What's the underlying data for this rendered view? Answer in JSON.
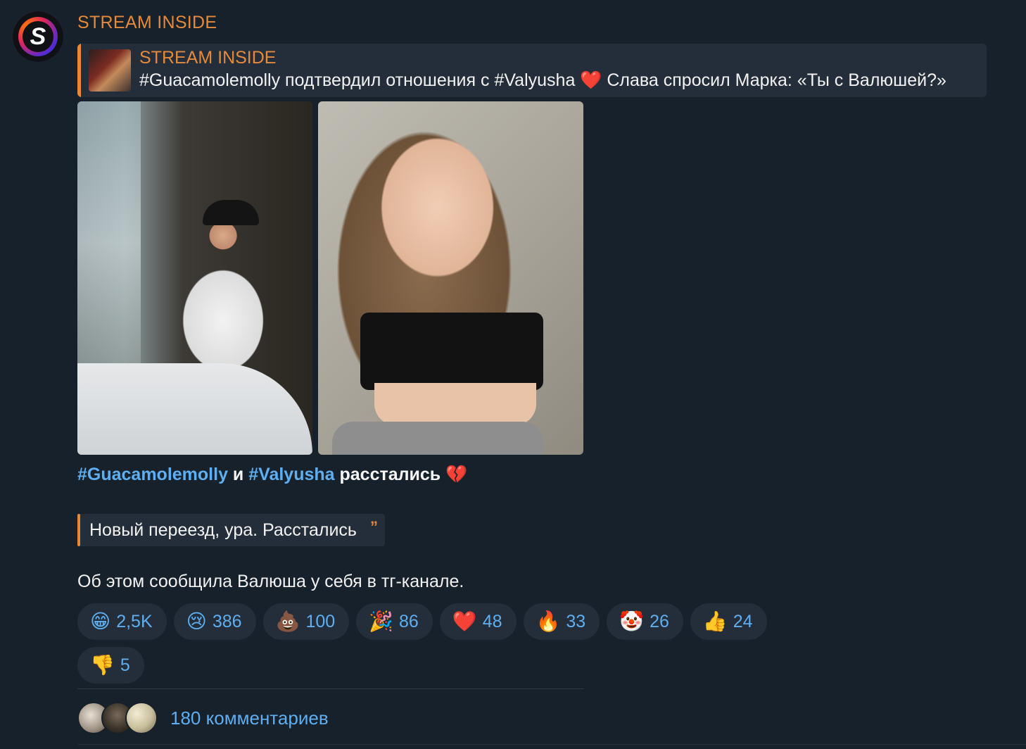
{
  "channel": {
    "name": "STREAM INSIDE",
    "avatar_letter": "S"
  },
  "forward": {
    "title": "STREAM INSIDE",
    "text": "#Guacamolemolly подтвердил отношения с #Valyusha ❤️  Слава спросил Марка: «Ты с Валюшей?»"
  },
  "post": {
    "line1": {
      "tag1": "#Guacamolemolly",
      "and": " и ",
      "tag2": "#Valyusha",
      "rest": " расстались 💔"
    },
    "quote": "Новый переезд, ура. Расстались",
    "quote_mark": "”",
    "line3": "Об этом сообщила Валюша у себя в тг-канале."
  },
  "reactions": [
    {
      "emoji": "😁",
      "count": "2,5K"
    },
    {
      "emoji": "😢",
      "count": "386"
    },
    {
      "emoji": "💩",
      "count": "100"
    },
    {
      "emoji": "🎉",
      "count": "86"
    },
    {
      "emoji": "❤️",
      "count": "48"
    },
    {
      "emoji": "🔥",
      "count": "33"
    },
    {
      "emoji": "🤡",
      "count": "26"
    },
    {
      "emoji": "👍",
      "count": "24"
    },
    {
      "emoji": "👎",
      "count": "5"
    }
  ],
  "comments": {
    "label": "180 комментариев"
  },
  "colors": {
    "background": "#17212b",
    "accent_orange": "#e58a3a",
    "link_blue": "#5eaef0",
    "bubble": "#232e3a"
  }
}
